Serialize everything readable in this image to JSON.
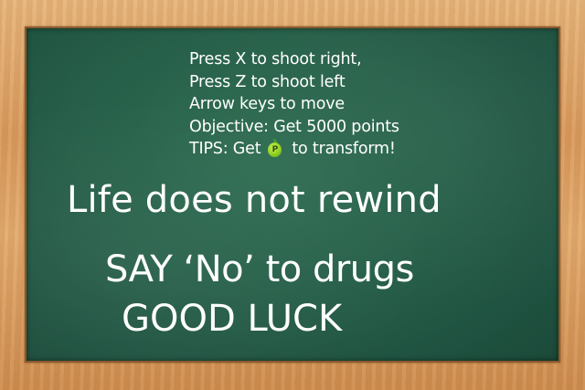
{
  "instructions": [
    "Press X to shoot right,",
    "Press Z to shoot left",
    "Arrow keys to move",
    "Objective: Get 5000 points"
  ],
  "tip": {
    "before": "TIPS: Get",
    "icon_letter": "P",
    "icon": "green-pepper-powerup-icon",
    "after": "to transform!"
  },
  "messages": {
    "line1": "Life does not rewind",
    "line2": "SAY ‘No’ to drugs",
    "line3": "GOOD LUCK"
  },
  "colors": {
    "board": "#27604a",
    "frame": "#dfa469",
    "text": "#ffffff",
    "powerup": "#8ccf1f"
  }
}
